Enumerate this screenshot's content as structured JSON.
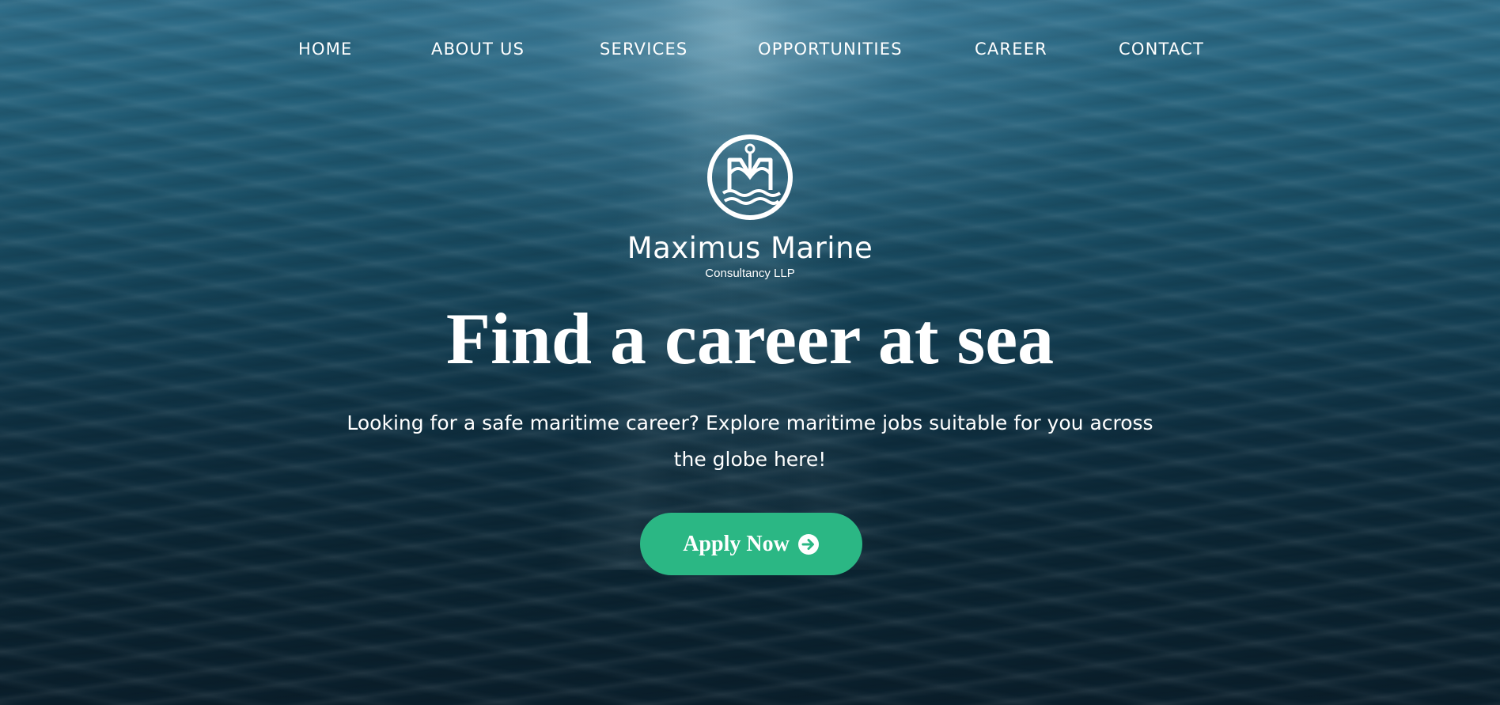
{
  "nav": {
    "items": [
      {
        "label": "HOME"
      },
      {
        "label": "ABOUT US"
      },
      {
        "label": "SERVICES"
      },
      {
        "label": "OPPORTUNITIES"
      },
      {
        "label": "CAREER"
      },
      {
        "label": "CONTACT"
      }
    ]
  },
  "brand": {
    "name": "Maximus Marine",
    "subtitle": "Consultancy LLP",
    "logo_icon": "anchor-m-waves-logo-icon"
  },
  "hero": {
    "headline": "Find a career at sea",
    "lead": "Looking for a safe maritime career? Explore maritime jobs suitable for you across the globe here!",
    "cta_label": "Apply Now",
    "cta_icon": "arrow-circle-right-icon"
  },
  "colors": {
    "cta_background": "#2bb784",
    "text": "#ffffff",
    "water_top": "#2f6e8a",
    "water_bottom": "#0a1f2c"
  }
}
